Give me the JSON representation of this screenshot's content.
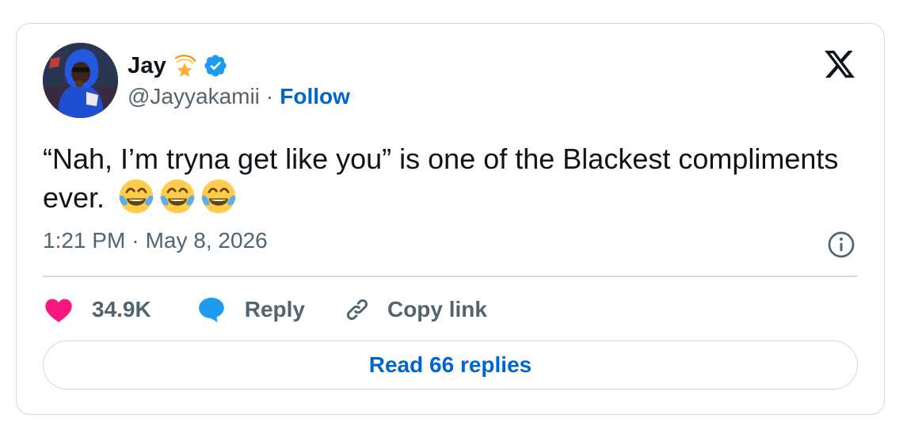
{
  "author": {
    "display_name": "Jay",
    "name_emoji": "dizzy-star-emoji",
    "verified_icon": "verified-badge-icon",
    "handle": "@Jayyakamii",
    "separator": "·",
    "follow_label": "Follow"
  },
  "tweet": {
    "text": "“Nah, I’m tryna get like you” is one of the Blackest compliments ever.",
    "emojis": [
      "face-with-tears-of-joy-emoji",
      "face-with-tears-of-joy-emoji",
      "face-with-tears-of-joy-emoji"
    ],
    "time": "1:21 PM",
    "separator": "·",
    "date": "May 8, 2026"
  },
  "actions": {
    "like_count": "34.9K",
    "reply_label": "Reply",
    "copy_link_label": "Copy link"
  },
  "footer": {
    "read_replies_label": "Read 66 replies"
  },
  "colors": {
    "heart": "#f91880",
    "reply_bubble": "#1d9bf0",
    "link_blue": "#0066cc",
    "verified": "#1d9bf0",
    "muted_text": "#536471",
    "border": "#cfd9de"
  }
}
